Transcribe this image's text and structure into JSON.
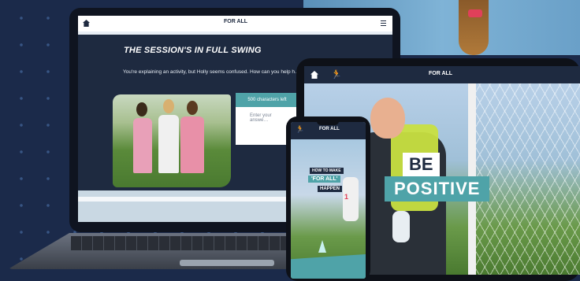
{
  "laptop": {
    "header_logo": "FOR ALL",
    "title": "THE SESSION'S IN FULL SWING",
    "prompt": "You're explaining an activity, but Holly seems confused. How can you help h… verbal explanation?",
    "counter": "500 characters left",
    "input_placeholder": "Enter your answe…"
  },
  "tablet": {
    "header_logo": "FOR ALL",
    "run_icon": "🏃",
    "headline_line1": "BE",
    "headline_line2": "POSITIVE"
  },
  "phone": {
    "header_logo": "FOR ALL",
    "run_icon": "🏃",
    "line1": "HOW TO MAKE",
    "line2": "'FOR ALL'",
    "line3": "HAPPEN",
    "shirt_number": "1"
  },
  "colors": {
    "background": "#1b2a4a",
    "navy": "#1e2a40",
    "teal": "#4fa3a8",
    "bib": "#c8e040"
  }
}
